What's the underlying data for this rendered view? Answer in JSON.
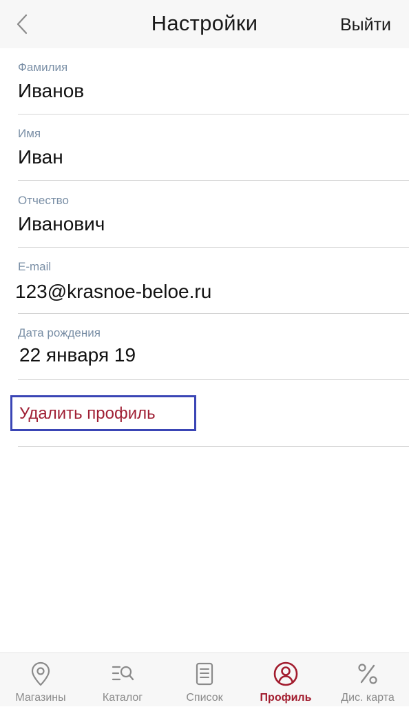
{
  "header": {
    "title": "Настройки",
    "logout_label": "Выйти"
  },
  "fields": [
    {
      "label": "Фамилия",
      "value": "Иванов"
    },
    {
      "label": "Имя",
      "value": "Иван"
    },
    {
      "label": "Отчество",
      "value": "Иванович"
    },
    {
      "label": "E-mail",
      "value": "123@krasnoe-beloe.ru"
    },
    {
      "label": "Дата рождения",
      "value": "22 января 19"
    }
  ],
  "delete_profile_label": "Удалить профиль",
  "tabs": [
    {
      "label": "Магазины",
      "icon": "location-pin-icon"
    },
    {
      "label": "Каталог",
      "icon": "catalog-search-icon"
    },
    {
      "label": "Список",
      "icon": "list-document-icon"
    },
    {
      "label": "Профиль",
      "icon": "profile-icon",
      "active": true
    },
    {
      "label": "Дис. карта",
      "icon": "percent-icon"
    }
  ],
  "colors": {
    "accent": "#a21c2e",
    "label": "#7a8fa6",
    "inactive": "#8a8a8a",
    "highlight_border": "#3a45b5",
    "bar_background": "#f7f7f7"
  }
}
